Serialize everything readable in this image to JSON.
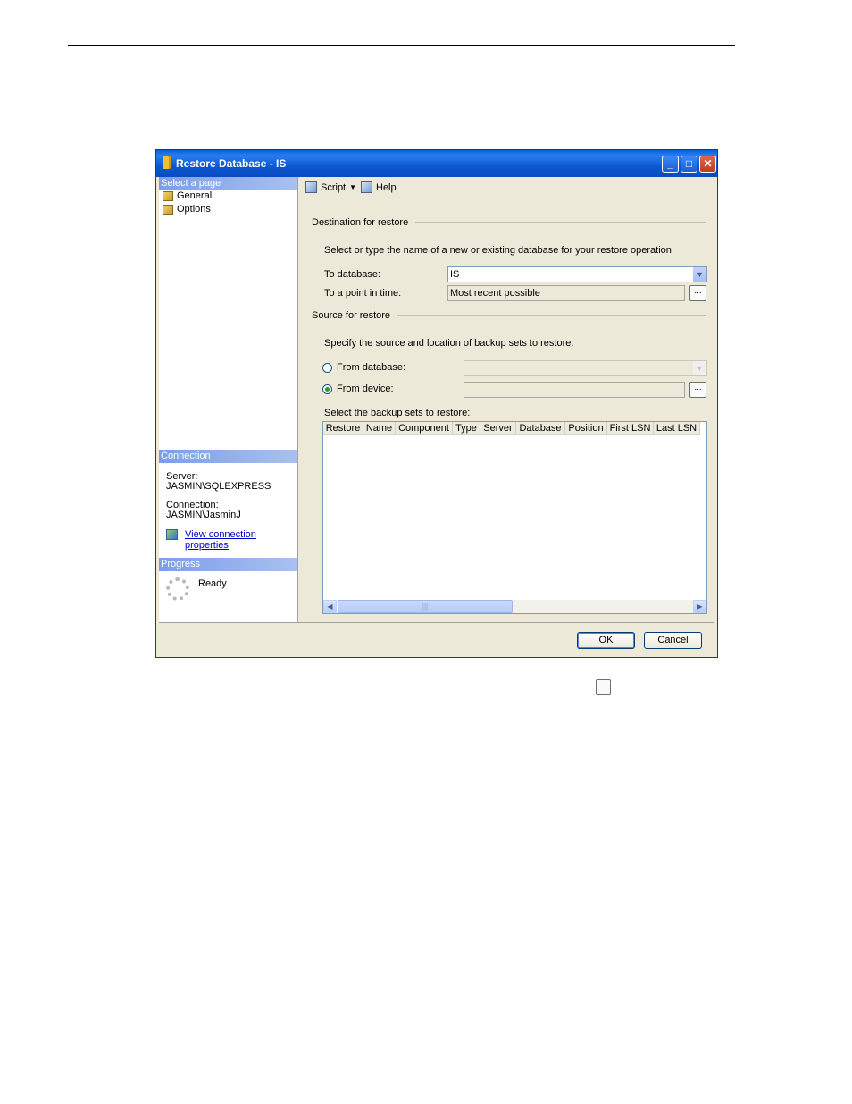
{
  "window": {
    "title": "Restore Database - IS"
  },
  "left": {
    "select_page_header": "Select a page",
    "pages": [
      {
        "label": "General"
      },
      {
        "label": "Options"
      }
    ],
    "connection_header": "Connection",
    "server_label": "Server:",
    "server_value": "JASMIN\\SQLEXPRESS",
    "connection_label": "Connection:",
    "connection_value": "JASMIN\\JasminJ",
    "view_props_link": "View connection properties",
    "progress_header": "Progress",
    "progress_status": "Ready"
  },
  "toolbar": {
    "script": "Script",
    "help": "Help"
  },
  "destination": {
    "group": "Destination for restore",
    "desc": "Select or type the name of a new or existing database for your restore operation",
    "to_database_label": "To database:",
    "to_database_value": "IS",
    "point_in_time_label": "To a point in time:",
    "point_in_time_value": "Most recent possible"
  },
  "source": {
    "group": "Source for restore",
    "desc": "Specify the source and location of backup sets to restore.",
    "from_database_label": "From database:",
    "from_device_label": "From device:",
    "selected_option": "From device:",
    "backup_sets_label": "Select the backup sets to restore:",
    "columns": [
      "Restore",
      "Name",
      "Component",
      "Type",
      "Server",
      "Database",
      "Position",
      "First LSN",
      "Last LSN"
    ]
  },
  "buttons": {
    "ok": "OK",
    "cancel": "Cancel",
    "ellipsis": "..."
  },
  "icons": {
    "db": "database-icon",
    "script": "script-icon",
    "help": "help-icon",
    "page": "page-icon",
    "link": "connection-icon",
    "spinner": "progress-spinner-icon"
  }
}
